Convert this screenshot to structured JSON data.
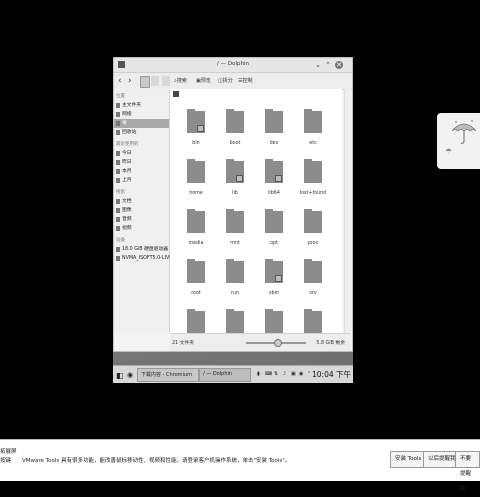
{
  "window": {
    "title": "/ — Dolphin",
    "min_glyph": "⌄",
    "max_glyph": "⌃",
    "close_glyph": "✕"
  },
  "toolbar": {
    "back": "‹",
    "forward": "›",
    "search": "搜索",
    "preview": "预览",
    "split": "拆分",
    "menu": "控制"
  },
  "sidebar": {
    "places_head": "位置",
    "places": [
      "主文件夹",
      "网络",
      "根",
      "回收站"
    ],
    "recent_head": "最近使用的",
    "recent": [
      "今日",
      "昨日",
      "本月",
      "上月"
    ],
    "search_head": "搜索",
    "search": [
      "文档",
      "图像",
      "音频",
      "视频"
    ],
    "devices_head": "设备",
    "devices": [
      "18.0 GiB 硬盘驱动器",
      "NVMA_ISOFT5.0-LIVECC"
    ]
  },
  "files": [
    "bin",
    "boot",
    "dev",
    "etc",
    "home",
    "lib",
    "lib64",
    "lost+found",
    "media",
    "mnt",
    "opt",
    "proc",
    "root",
    "run",
    "sbin",
    "srv",
    "",
    "",
    "",
    ""
  ],
  "status": {
    "count": "21 文件夹",
    "free": "5.8 GiB 剩余"
  },
  "desktop": {
    "label": "系统"
  },
  "taskbar": {
    "task1": "下载内容 - Chromium",
    "task2": "/ — Dolphin",
    "clock": "10:04 下午"
  },
  "notification": {
    "icon_label_1": "拓展屏",
    "icon_label_2": "按键",
    "message": "VMware Tools 具有很多功能，能改善鼠标移动性、视频和性能。请登录客户机操作系统，单击\"安装 Tools\"。",
    "install": "安装 Tools",
    "remind": "以后提醒我",
    "never": "不要提醒我"
  }
}
